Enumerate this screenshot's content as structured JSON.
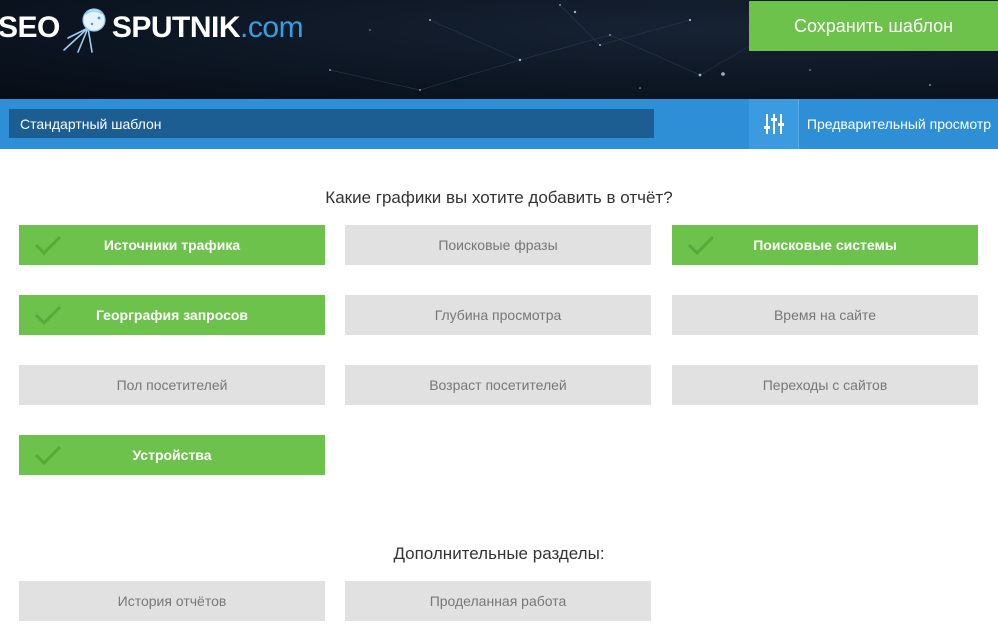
{
  "brand": {
    "seo": "SEO",
    "sputnik": "SPUTNIK",
    "com": ".com"
  },
  "header": {
    "save_label": "Сохранить шаблон"
  },
  "toolbar": {
    "template_value": "Стандартный шаблон",
    "settings_icon": "sliders-icon",
    "preview_label": "Предварительный просмотр"
  },
  "charts_section": {
    "title": "Какие графики вы хотите добавить в отчёт?",
    "options": [
      {
        "label": "Источники трафика",
        "selected": true
      },
      {
        "label": "Поисковые фразы",
        "selected": false
      },
      {
        "label": "Поисковые системы",
        "selected": true
      },
      {
        "label": "Георграфия запросов",
        "selected": true
      },
      {
        "label": "Глубина просмотра",
        "selected": false
      },
      {
        "label": "Время на сайте",
        "selected": false
      },
      {
        "label": "Пол посетителей",
        "selected": false
      },
      {
        "label": "Возраст посетителей",
        "selected": false
      },
      {
        "label": "Переходы с сайтов",
        "selected": false
      },
      {
        "label": "Устройства",
        "selected": true
      }
    ]
  },
  "extra_section": {
    "title": "Дополнительные разделы:",
    "options": [
      {
        "label": "История отчётов",
        "selected": false
      },
      {
        "label": "Проделанная работа",
        "selected": false
      }
    ]
  },
  "colors": {
    "selected": "#6cc24a",
    "unselected": "#e1e1e1",
    "toolbar": "#2f8fd6",
    "header": "#0c1522",
    "brand_accent": "#34a0e0"
  }
}
